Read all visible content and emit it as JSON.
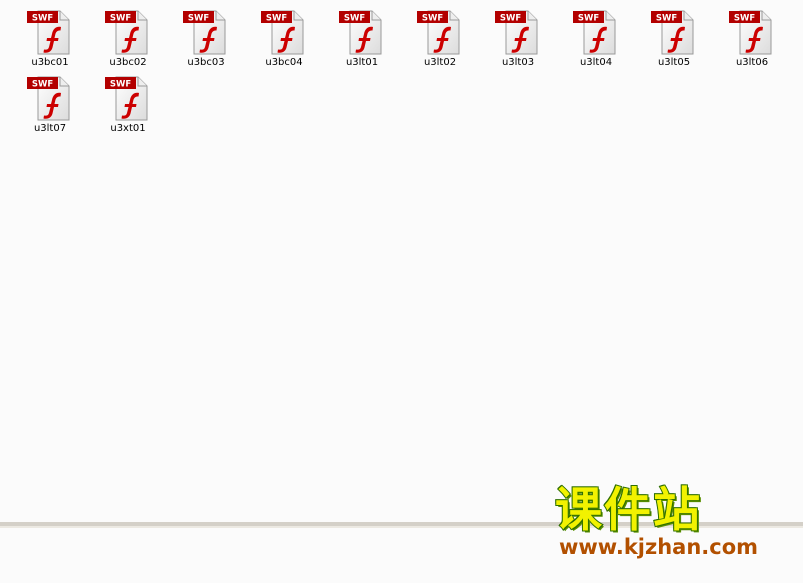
{
  "files": [
    {
      "name": "u3bc01",
      "badge": "SWF",
      "icon": "swf-file-icon"
    },
    {
      "name": "u3bc02",
      "badge": "SWF",
      "icon": "swf-file-icon"
    },
    {
      "name": "u3bc03",
      "badge": "SWF",
      "icon": "swf-file-icon"
    },
    {
      "name": "u3bc04",
      "badge": "SWF",
      "icon": "swf-file-icon"
    },
    {
      "name": "u3lt01",
      "badge": "SWF",
      "icon": "swf-file-icon"
    },
    {
      "name": "u3lt02",
      "badge": "SWF",
      "icon": "swf-file-icon"
    },
    {
      "name": "u3lt03",
      "badge": "SWF",
      "icon": "swf-file-icon"
    },
    {
      "name": "u3lt04",
      "badge": "SWF",
      "icon": "swf-file-icon"
    },
    {
      "name": "u3lt05",
      "badge": "SWF",
      "icon": "swf-file-icon"
    },
    {
      "name": "u3lt06",
      "badge": "SWF",
      "icon": "swf-file-icon"
    },
    {
      "name": "u3lt07",
      "badge": "SWF",
      "icon": "swf-file-icon"
    },
    {
      "name": "u3xt01",
      "badge": "SWF",
      "icon": "swf-file-icon"
    }
  ],
  "watermark": {
    "chinese": "课件站",
    "url": "www.kjzhan.com"
  },
  "colors": {
    "background": "#fbfbfb",
    "badge_red": "#b30000",
    "flash_red": "#cc0000",
    "separator": "#d4d0c8",
    "watermark_yellow": "#f2f200",
    "watermark_green": "#2f6f00",
    "watermark_brown": "#b25000"
  }
}
